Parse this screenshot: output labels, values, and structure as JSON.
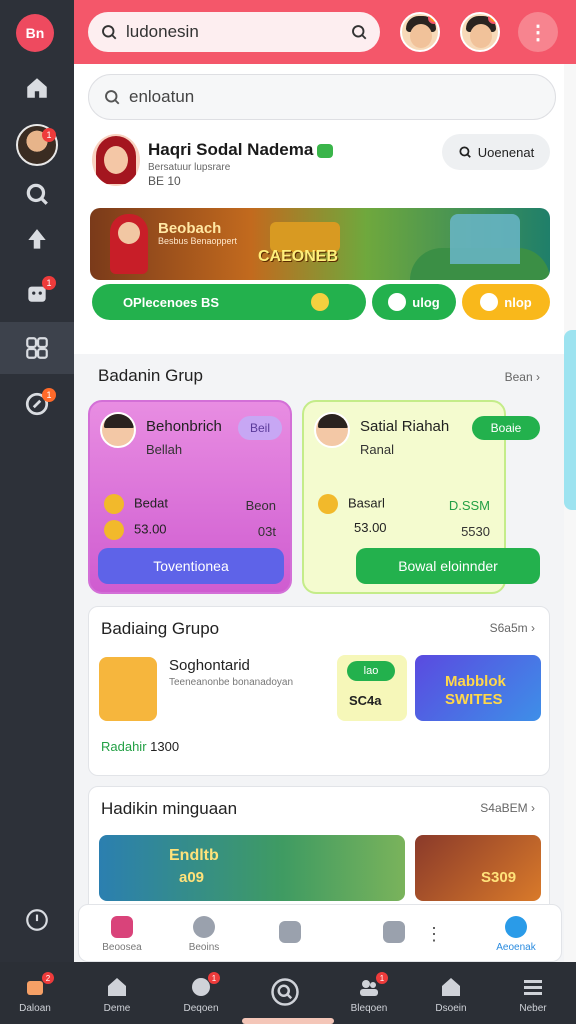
{
  "rail": {
    "logo": "Bn",
    "items": [
      {
        "icon": "home-icon"
      },
      {
        "icon": "avatar",
        "badge": "1"
      },
      {
        "icon": "search-icon"
      },
      {
        "icon": "rocket-icon"
      },
      {
        "icon": "bag-icon",
        "badge": "1"
      },
      {
        "icon": "grid-icon"
      },
      {
        "icon": "compass-icon",
        "badge": "1"
      },
      {
        "icon": "clock-icon"
      }
    ]
  },
  "topbar": {
    "search_text": "ludonesin",
    "menu_icon": "more-vertical-icon"
  },
  "main_search": {
    "text": "enloatun"
  },
  "profile": {
    "name": "Haqri Sodal Nadema",
    "sub": "Bersatuur lupsrare",
    "meta": "BE 10",
    "action_label": "Uoenenat"
  },
  "banner": {
    "title": "Beobach",
    "subtitle": "Besbus Benaoppert",
    "cta": "CAEONEB"
  },
  "pills": [
    {
      "label": "OPlecenoes BS"
    },
    {
      "label": "ulog"
    },
    {
      "label": "nlop"
    }
  ],
  "group_section": {
    "title": "Badanin Grup",
    "link": "Bean",
    "cards": [
      {
        "title": "Behonbrich",
        "sub": "Bellah",
        "tag": "Beil",
        "row1_label": "Bedat",
        "row1_value": "Beon",
        "row2_label": "53.00",
        "row2_value": "03t",
        "button": "Toventionea"
      },
      {
        "title": "Satial Riahah",
        "sub": "Ranal",
        "tag": "Boaie",
        "row1_label": "Basarl",
        "row1_value": "D.SSM",
        "row2_label": "53.00",
        "row2_value": "5530",
        "button": "Bowal eloinnder"
      }
    ]
  },
  "list1": {
    "title": "Badiaing Grupo",
    "link": "S6a5m",
    "item_title": "Soghontarid",
    "item_sub": "Teeneanonbe bonanadoyan",
    "badge_small": "lao",
    "badge_value": "SC4a",
    "promo": "Mabblok SWITES",
    "footer": "Radahir",
    "footer_value": "1300"
  },
  "list2": {
    "title": "Hadikin minguaan",
    "link": "S4aBEM",
    "tile1": "Endltb",
    "tile1_sub": "a09",
    "tile2_value": "S309"
  },
  "inner_nav": [
    {
      "label": "Beoosea"
    },
    {
      "label": "Beoins"
    },
    {
      "label": ""
    },
    {
      "label": ""
    },
    {
      "label": ""
    },
    {
      "label": "Aeoenak"
    }
  ],
  "bottom_nav": [
    {
      "label": "Daloan"
    },
    {
      "label": "Deme"
    },
    {
      "label": "Deqoen"
    },
    {
      "label": ""
    },
    {
      "label": "Bleqoen"
    },
    {
      "label": "Dsoein"
    },
    {
      "label": "Neber"
    }
  ],
  "colors": {
    "brand": "#f4576a",
    "green": "#23b14d",
    "purple": "#5e63e8",
    "yellow": "#f9b81b"
  }
}
